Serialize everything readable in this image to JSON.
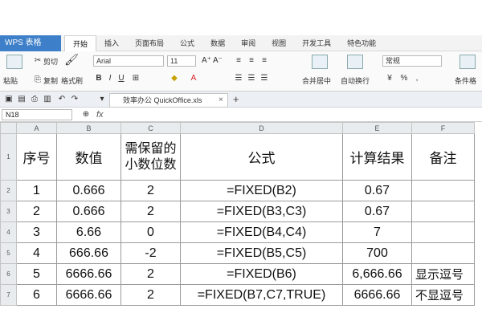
{
  "app": {
    "title": "WPS 表格"
  },
  "menu": {
    "tabs": [
      "开始",
      "插入",
      "页面布局",
      "公式",
      "数据",
      "审阅",
      "视图",
      "开发工具",
      "特色功能"
    ],
    "active": "开始"
  },
  "ribbon": {
    "paste": "粘贴",
    "cut": "剪切",
    "copy": "复制",
    "format_painter": "格式刷",
    "font_name": "Arial",
    "font_size": "11",
    "merge_center": "合并居中",
    "wrap_text": "自动换行",
    "number_format": "常规",
    "conditional_format": "条件格"
  },
  "document": {
    "tab_name": "效率办公 QuickOffice.xls"
  },
  "formula_bar": {
    "name_box": "N18",
    "fx": "fx"
  },
  "sheet": {
    "columns": [
      "A",
      "B",
      "C",
      "D",
      "E",
      "F"
    ],
    "header": {
      "row_no": "1",
      "cells": [
        "序号",
        "数值",
        "需保留的小数位数",
        "公式",
        "计算结果",
        "备注"
      ]
    },
    "rows": [
      {
        "row_no": "2",
        "cells": [
          "1",
          "0.666",
          "2",
          "=FIXED(B2)",
          "0.67",
          ""
        ]
      },
      {
        "row_no": "3",
        "cells": [
          "2",
          "0.666",
          "2",
          "=FIXED(B3,C3)",
          "0.67",
          ""
        ]
      },
      {
        "row_no": "4",
        "cells": [
          "3",
          "6.66",
          "0",
          "=FIXED(B4,C4)",
          "7",
          ""
        ]
      },
      {
        "row_no": "5",
        "cells": [
          "4",
          "666.66",
          "-2",
          "=FIXED(B5,C5)",
          "700",
          ""
        ]
      },
      {
        "row_no": "6",
        "cells": [
          "5",
          "6666.66",
          "2",
          "=FIXED(B6)",
          "6,666.66",
          "显示逗号"
        ]
      },
      {
        "row_no": "7",
        "cells": [
          "6",
          "6666.66",
          "2",
          "=FIXED(B7,C7,TRUE)",
          "6666.66",
          "不显逗号"
        ]
      }
    ]
  },
  "colors": {
    "app_button": "#3d7fc8",
    "grid": "#9a9a9a",
    "header_bg": "#e9ecef"
  }
}
